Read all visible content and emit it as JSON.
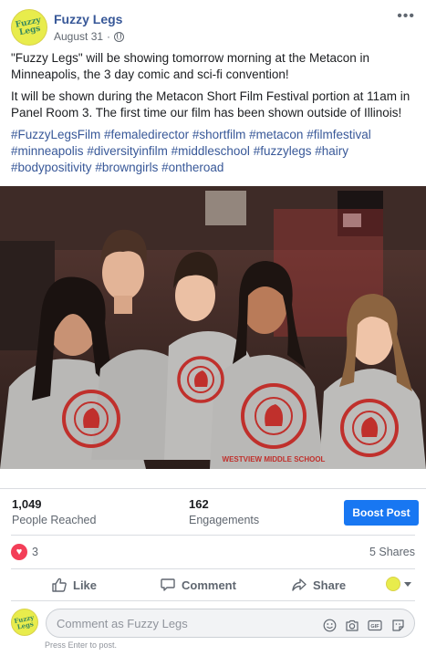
{
  "post": {
    "page_name": "Fuzzy Legs",
    "avatar_text": "Fuzzy Legs",
    "date": "August 31",
    "privacy_icon": "globe-icon",
    "more_icon": "more-dots-icon",
    "paragraph_1": "\"Fuzzy Legs\" will be showing tomorrow morning at the Metacon in Minneapolis, the 3 day comic and sci-fi convention!",
    "paragraph_2": "It will be shown during the Metacon Short Film Festival portion at 11am in Panel Room 3. The first time our film has been shown outside of Illinois!",
    "hashtags": [
      "#FuzzyLegsFilm",
      "#femaledirector",
      "#shortfilm",
      "#metacon",
      "#filmfestival",
      "#minneapolis",
      "#diversityinfilm",
      "#middleschool",
      "#fuzzylegs",
      "#hairy",
      "#bodypositivity",
      "#browngirls",
      "#ontheroad"
    ],
    "photo_shirt_text": "WESTVIEW MIDDLE SCHOOL"
  },
  "insights": {
    "reached_value": "1,049",
    "reached_label": "People Reached",
    "engagements_value": "162",
    "engagements_label": "Engagements",
    "boost_label": "Boost Post"
  },
  "reactions": {
    "count": "3",
    "shares": "5 Shares",
    "reaction_icon": "heart-icon"
  },
  "actions": {
    "like_label": "Like",
    "comment_label": "Comment",
    "share_label": "Share"
  },
  "comment_box": {
    "placeholder": "Comment as Fuzzy Legs",
    "hint": "Press Enter to post.",
    "icons": [
      "emoji-icon",
      "camera-icon",
      "gif-icon",
      "sticker-icon"
    ]
  },
  "colors": {
    "link": "#385898",
    "boost": "#1877f2",
    "heart": "#f33e58",
    "shirt": "#bdbdbd",
    "shirt_logo": "#c0302c"
  }
}
